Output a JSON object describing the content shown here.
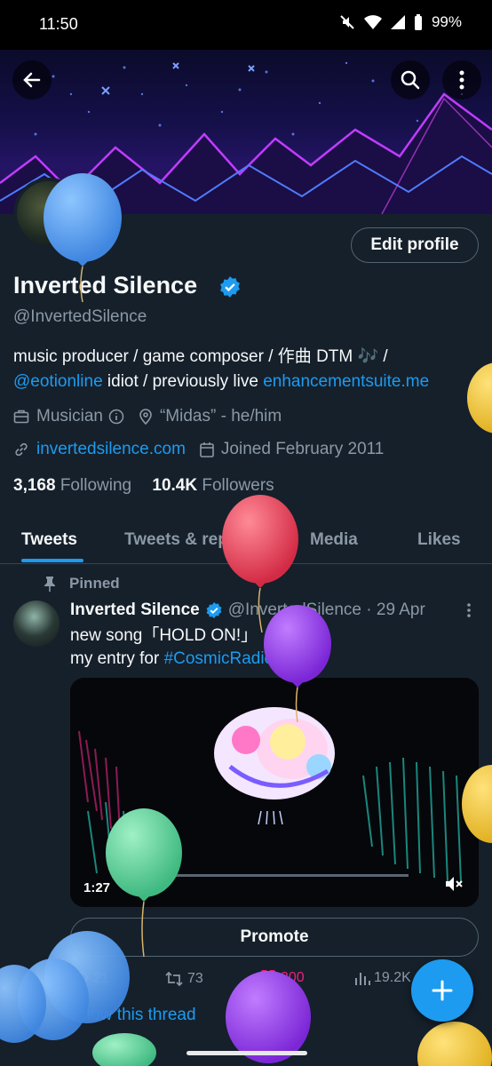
{
  "status": {
    "time": "11:50",
    "battery": "99%"
  },
  "profile": {
    "display_name": "Inverted Silence",
    "handle": "@InvertedSilence",
    "edit_label": "Edit profile",
    "bio_line1_text": "music producer / game composer / 作曲 DTM 🎶 /",
    "bio_mention": "@eotionline",
    "bio_mid": " idiot / previously live ",
    "bio_link": "enhancementsuite.me",
    "category": "Musician",
    "location": "“Midas” - he/him",
    "website": "invertedsilence.com",
    "joined": "Joined February 2011",
    "following_count": "3,168",
    "following_label": "Following",
    "followers_count": "10.4K",
    "followers_label": "Followers"
  },
  "tabs": {
    "tweets": "Tweets",
    "replies": "Tweets & replies",
    "media": "Media",
    "likes": "Likes"
  },
  "tweet": {
    "pinned_label": "Pinned",
    "author": "Inverted Silence",
    "handle_date": "@InvertedSilence · 29 Apr",
    "line1": "new song「HOLD ON!」",
    "line2_prefix": "my entry for ",
    "hashtag": "#CosmicRadio2024",
    "video_time": "1:27",
    "promote_label": "Promote",
    "replies": "21",
    "retweets": "73",
    "likes": "300",
    "views": "19.2K",
    "show_thread": "Show this thread"
  },
  "colors": {
    "background": "#15202b",
    "accent": "#1d9bf0",
    "secondary_text": "#8b98a5"
  }
}
